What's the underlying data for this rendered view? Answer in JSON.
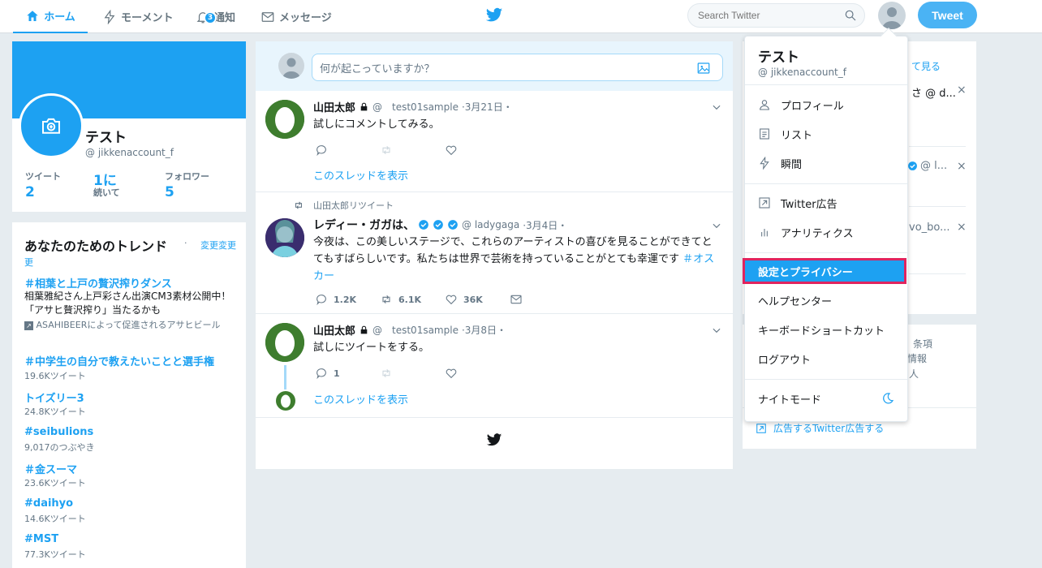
{
  "nav": {
    "home": "ホーム",
    "moments": "モーメント",
    "notifications": "通知",
    "notifications_count": "3",
    "messages": "メッセージ"
  },
  "search": {
    "placeholder": "Search Twitter"
  },
  "tweet_button": "Tweet",
  "profile": {
    "name": "テスト",
    "handle": "@ jikkenaccount_f",
    "stats": [
      {
        "label": "ツイート",
        "value": "2"
      },
      {
        "label": "続いて",
        "value": "1に"
      },
      {
        "label": "フォロワー",
        "value": "5"
      }
    ]
  },
  "trends": {
    "title": "あなたのためのトレンド",
    "change": "変更変更",
    "items": [
      {
        "tag": "＃相葉と上戸の贅沢搾りダンス",
        "desc": "相葉雅紀さん上戸彩さん出演CM3素材公開中！「アサヒ贅沢搾り」当たるかも",
        "promo": "ASAHIBEERによって促進されるアサヒビール"
      },
      {
        "tag": "＃中学生の自分で教えたいことと選手権",
        "sub": "19.6Kツイート"
      },
      {
        "tag": "トイズリー3",
        "sub": "24.8Kツイート"
      },
      {
        "tag": "#seibulions",
        "sub": "9,017のつぶやき"
      },
      {
        "tag": "＃金スーマ",
        "sub": "23.6Kツイート"
      },
      {
        "tag": "#daihyo",
        "sub": "14.6Kツイート"
      },
      {
        "tag": "#MST",
        "sub": "77.3Kツイート"
      }
    ]
  },
  "composer": {
    "placeholder": "何が起こっていますか？"
  },
  "timeline": [
    {
      "name": "山田太郎",
      "handle": "@　test01sample",
      "date": "·3月21日・",
      "text": "試しにコメントしてみる。",
      "thread": "このスレッドを表示"
    },
    {
      "retweeted_by": "山田太郎リツイート",
      "name": "レディー・ガガは、",
      "handle": "@ ladygaga",
      "date": "·3月4日・",
      "text": "今夜は、この美しいステージで、これらのアーティストの喜びを見ることができてとてもすばらしいです。私たちは世界で芸術を持っていることがとても幸運です",
      "hashtag": "＃オスカー",
      "replies": "1.2K",
      "retweets": "6.1K",
      "likes": "36K"
    },
    {
      "name": "山田太郎",
      "handle": "@　test01sample",
      "date": "·3月8日・",
      "text": "試しにツイートをする。",
      "replies": "1",
      "thread": "このスレッドを表示"
    }
  ],
  "dropdown": {
    "name": "テスト",
    "handle": "@ jikkenaccount_f",
    "items": [
      "プロフィール",
      "リスト",
      "瞬間",
      "Twitter広告",
      "アナリティクス",
      "設定とプライバシー",
      "ヘルプセンター",
      "キーボードショートカット",
      "ログアウト",
      "ナイトモード"
    ]
  },
  "right_fragments": {
    "see_all": "て見る",
    "user1": "さ @ d...",
    "user2": "@ l...",
    "user3": "vo_bo...",
    "footer1": "条項",
    "footer2": "情報",
    "footer3": "人",
    "ads": "広告するTwitter広告する"
  },
  "colors": {
    "accent": "#1da1f2",
    "highlight_border": "#e0245e"
  }
}
